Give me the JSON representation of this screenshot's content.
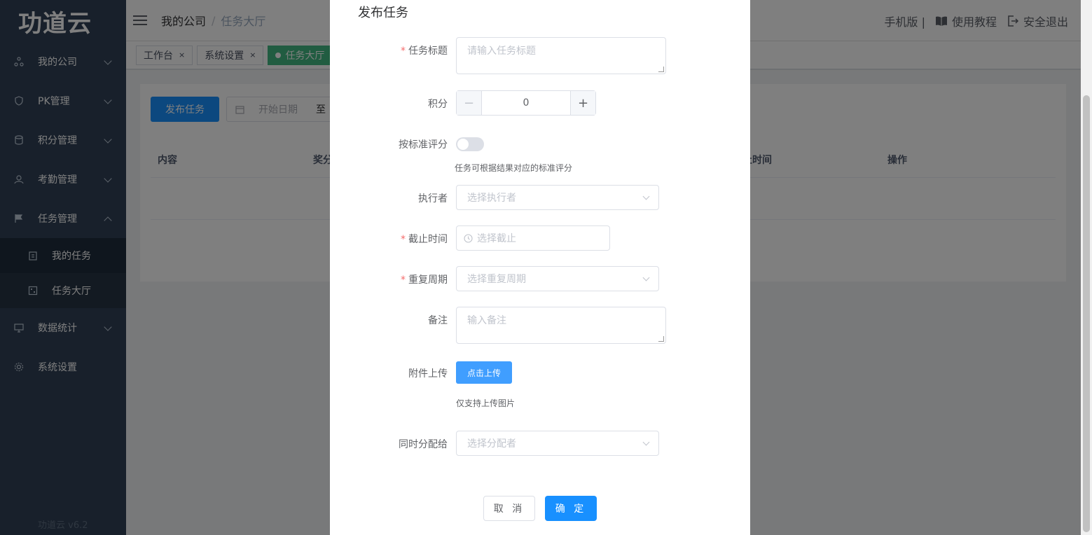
{
  "app": {
    "logo": "功道云",
    "version": "功道云 v6.2"
  },
  "sidebar": {
    "items": [
      {
        "label": "我的公司",
        "icon": "org-icon"
      },
      {
        "label": "PK管理",
        "icon": "shield-icon"
      },
      {
        "label": "积分管理",
        "icon": "database-icon"
      },
      {
        "label": "考勤管理",
        "icon": "user-icon"
      },
      {
        "label": "任务管理",
        "icon": "flag-icon"
      },
      {
        "label": "数据统计",
        "icon": "monitor-icon"
      },
      {
        "label": "系统设置",
        "icon": "gear-icon"
      }
    ],
    "sub_items": [
      {
        "label": "我的任务",
        "icon": "clipboard-icon"
      },
      {
        "label": "任务大厅",
        "icon": "grid-icon"
      }
    ]
  },
  "header": {
    "breadcrumb": [
      "我的公司",
      "任务大厅"
    ],
    "mobile": "手机版 |",
    "tutorial": "使用教程",
    "logout": "安全退出"
  },
  "tags": [
    {
      "label": "工作台",
      "close": "×"
    },
    {
      "label": "系统设置",
      "close": "×"
    },
    {
      "label": "任务大厅"
    }
  ],
  "main": {
    "publish_button": "发布任务",
    "date_start_placeholder": "开始日期",
    "date_to": "至",
    "columns": [
      "内容",
      "奖分",
      "止时间",
      "操作"
    ]
  },
  "dialog": {
    "title": "发布任务",
    "title_label": "任务标题",
    "title_placeholder": "请输入任务标题",
    "points_label": "积分",
    "points_value": "0",
    "standard_label": "按标准评分",
    "standard_hint": "任务可根据结果对应的标准评分",
    "executor_label": "执行者",
    "executor_placeholder": "选择执行者",
    "deadline_label": "截止时间",
    "deadline_placeholder": "选择截止",
    "repeat_label": "重复周期",
    "repeat_placeholder": "选择重复周期",
    "remark_label": "备注",
    "remark_placeholder": "输入备注",
    "attach_label": "附件上传",
    "upload_button": "点击上传",
    "upload_hint": "仅支持上传图片",
    "assign_label": "同时分配给",
    "assign_placeholder": "选择分配者",
    "cancel": "取 消",
    "confirm": "确 定",
    "required_mark": "*",
    "minus": "−",
    "plus": "+"
  },
  "colors": {
    "sidebar": "#304156",
    "primary": "#1890ff",
    "active_tag": "#42b983"
  }
}
